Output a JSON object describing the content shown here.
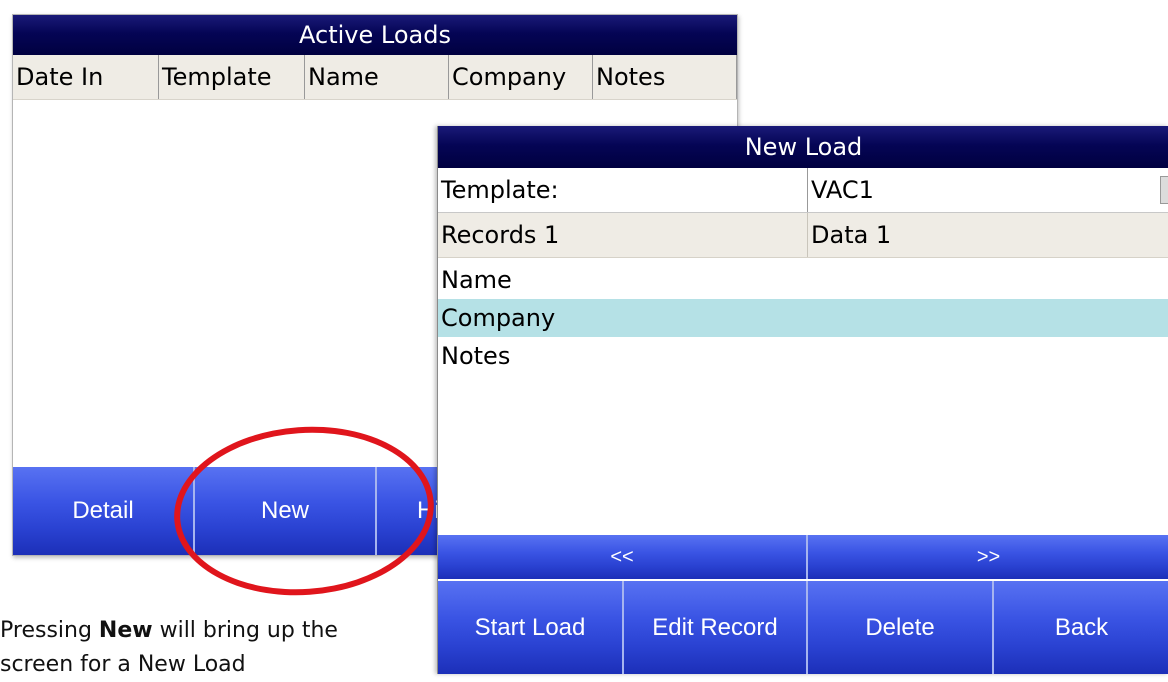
{
  "active_loads": {
    "title": "Active Loads",
    "columns": [
      "Date In",
      "Template",
      "Name",
      "Company",
      "Notes"
    ],
    "buttons": [
      "Detail",
      "New",
      "Hi"
    ]
  },
  "new_load": {
    "title": "New Load",
    "template_label": "Template:",
    "template_value": "VAC1",
    "header_left": "Records 1",
    "header_right": "Data 1",
    "fields": [
      "Name",
      "Company",
      "Notes"
    ],
    "selected_index": 1,
    "nav_prev": "<<",
    "nav_next": ">>",
    "buttons": [
      "Start Load",
      "Edit Record",
      "Delete",
      "Back"
    ]
  },
  "caption": {
    "prefix": "Pressing ",
    "bold": "New",
    "suffix": " will bring up the",
    "line2": "screen for a New Load"
  },
  "colors": {
    "title_bar": "#000040",
    "button_blue": "#3a54e4",
    "selection": "#b5e1e6",
    "header_bg": "#efece5",
    "highlight_circle": "#e0151c"
  }
}
